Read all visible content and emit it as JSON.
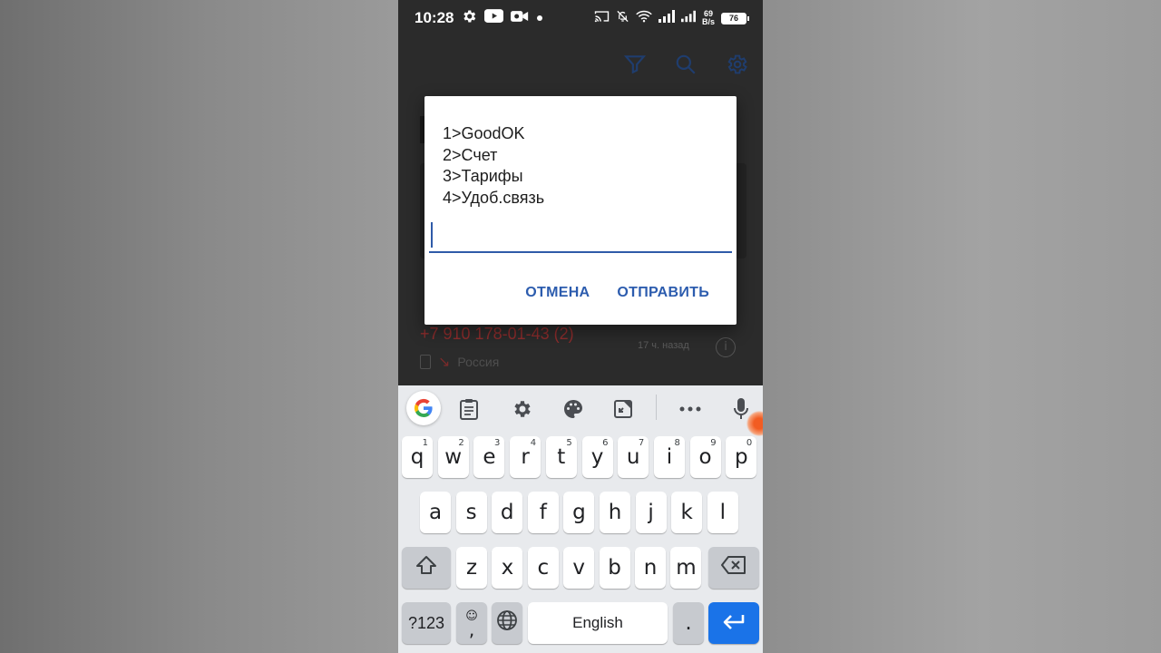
{
  "status_bar": {
    "time": "10:28",
    "net_speed_value": "69",
    "net_speed_unit": "B/s",
    "battery": "76"
  },
  "background_app": {
    "phone_entry": "+7 910 178-01-43 (2)",
    "entry_time": "17 ч. назад",
    "country": "Россия"
  },
  "dialog": {
    "lines": [
      "1>GoodOK",
      "2>Счет",
      "3>Тарифы",
      "4>Удоб.связь"
    ],
    "input_value": "",
    "cancel_label": "ОТМЕНА",
    "send_label": "ОТПРАВИТЬ",
    "accent_color": "#2c5cae"
  },
  "keyboard": {
    "row1": [
      {
        "key": "q",
        "hint": "1"
      },
      {
        "key": "w",
        "hint": "2"
      },
      {
        "key": "e",
        "hint": "3"
      },
      {
        "key": "r",
        "hint": "4"
      },
      {
        "key": "t",
        "hint": "5"
      },
      {
        "key": "y",
        "hint": "6"
      },
      {
        "key": "u",
        "hint": "7"
      },
      {
        "key": "i",
        "hint": "8"
      },
      {
        "key": "o",
        "hint": "9"
      },
      {
        "key": "p",
        "hint": "0"
      }
    ],
    "row2": [
      "a",
      "s",
      "d",
      "f",
      "g",
      "h",
      "j",
      "k",
      "l"
    ],
    "row3": [
      "z",
      "x",
      "c",
      "v",
      "b",
      "n",
      "m"
    ],
    "symbols_label": "?123",
    "emoji_comma_label": ",",
    "space_label": "English",
    "period_label": ".",
    "toolbar_icons": [
      "google-icon",
      "clipboard-icon",
      "gear-icon",
      "palette-icon",
      "translate-icon",
      "more-icon",
      "mic-icon"
    ],
    "enter_color": "#1a73e8"
  }
}
